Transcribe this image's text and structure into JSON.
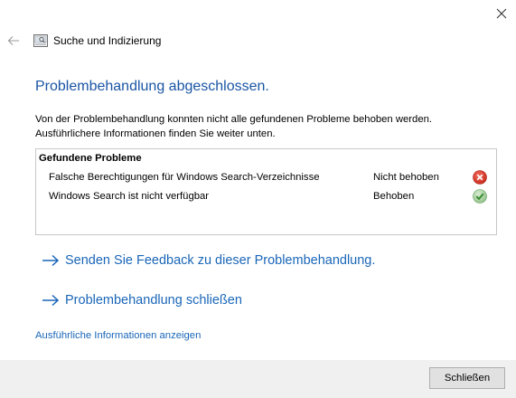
{
  "window": {
    "title": "Suche und Indizierung",
    "close_icon": "close-icon",
    "back_icon": "back-arrow-icon",
    "app_icon": "search-indexing-icon"
  },
  "main": {
    "heading": "Problembehandlung abgeschlossen.",
    "description": "Von der Problembehandlung konnten nicht alle gefundenen Probleme behoben werden. Ausführlichere Informationen finden Sie weiter unten."
  },
  "problems": {
    "title": "Gefundene Probleme",
    "rows": [
      {
        "name": "Falsche Berechtigungen für Windows Search-Verzeichnisse",
        "status": "Nicht behoben",
        "icon": "error-icon"
      },
      {
        "name": "Windows Search ist nicht verfügbar",
        "status": "Behoben",
        "icon": "check-icon"
      }
    ]
  },
  "links": {
    "feedback": "Senden Sie Feedback zu dieser Problembehandlung.",
    "close_troubleshooter": "Problembehandlung schließen",
    "details": "Ausführliche Informationen anzeigen"
  },
  "footer": {
    "close_button": "Schließen"
  },
  "colors": {
    "accent": "#1a66b8",
    "heading": "#1a55a5",
    "error": "#d9352a",
    "success": "#3a9a3a"
  }
}
